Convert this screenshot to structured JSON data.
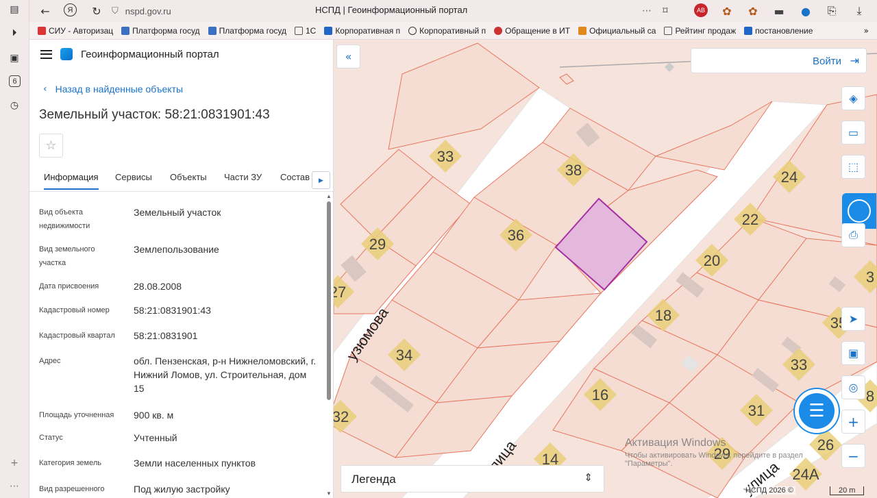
{
  "browser": {
    "url": "nspd.gov.ru",
    "tab_title": "НСПД | Геоинформационный портал",
    "sidebar_badge": "6",
    "bookmarks": [
      {
        "label": "СИУ - Авторизац",
        "color": "#d33"
      },
      {
        "label": "Платформа госуд",
        "color": "#3a6fc4"
      },
      {
        "label": "Платформа госуд",
        "color": "#3a6fc4"
      },
      {
        "label": "1С",
        "color": "#555"
      },
      {
        "label": "Корпоративная п",
        "color": "#1f66c6"
      },
      {
        "label": "Корпоративный п",
        "color": "#333"
      },
      {
        "label": "Обращение в ИТ",
        "color": "#c33"
      },
      {
        "label": "Официальный са",
        "color": "#e08a1e"
      },
      {
        "label": "Рейтинг продаж",
        "color": "#555"
      },
      {
        "label": "постановление",
        "color": "#1f66c6"
      }
    ]
  },
  "panel": {
    "app_title": "Геоинформационный портал",
    "back_link": "Назад в найденные объекты",
    "object_title": "Земельный участок: 58:21:0831901:43",
    "tabs": [
      "Информация",
      "Сервисы",
      "Объекты",
      "Части ЗУ",
      "Состав"
    ],
    "rows": [
      {
        "label": "Вид объекта недвижимости",
        "value": "Земельный участок"
      },
      {
        "label": "Вид земельного участка",
        "value": "Землепользование"
      },
      {
        "label": "Дата присвоения",
        "value": "28.08.2008"
      },
      {
        "label": "Кадастровый номер",
        "value": "58:21:0831901:43"
      },
      {
        "label": "Кадастровый квартал",
        "value": "58:21:0831901"
      },
      {
        "label": "Адрес",
        "value": "обл. Пензенская, р-н Нижнеломовский, г. Нижний Ломов, ул. Строительная, дом 15"
      },
      {
        "label": "Площадь уточненная",
        "value": "900 кв. м"
      },
      {
        "label": "Статус",
        "value": "Учтенный"
      },
      {
        "label": "Категория земель",
        "value": "Земли населенных пунктов"
      },
      {
        "label": "Вид разрешенного",
        "value": "Под жилую застройку"
      }
    ]
  },
  "map": {
    "login_label": "Войти",
    "legend_label": "Легенда",
    "street_labels": [
      "узюмова",
      "улица",
      "улица"
    ],
    "parcel_numbers": [
      "33",
      "38",
      "24",
      "22",
      "36",
      "29",
      "20",
      "27",
      "18",
      "34",
      "35",
      "33",
      "16",
      "32",
      "31",
      "29",
      "26",
      "14",
      "24А",
      "3",
      "8"
    ],
    "windows_activation": {
      "title": "Активация Windows",
      "subtitle": "Чтобы активировать Windows, перейдите в раздел \"Параметры\"."
    },
    "attribution": "НСПД 2026 ©",
    "scale_label": "20 m",
    "colors": {
      "accent": "#1a73c8",
      "parcel_border": "#e8765e",
      "parcel_fill": "#f6ddd4",
      "selected_fill": "#e4b7dd",
      "selected_border": "#a52fa3",
      "house_label_bg": "#e9cf79"
    }
  }
}
